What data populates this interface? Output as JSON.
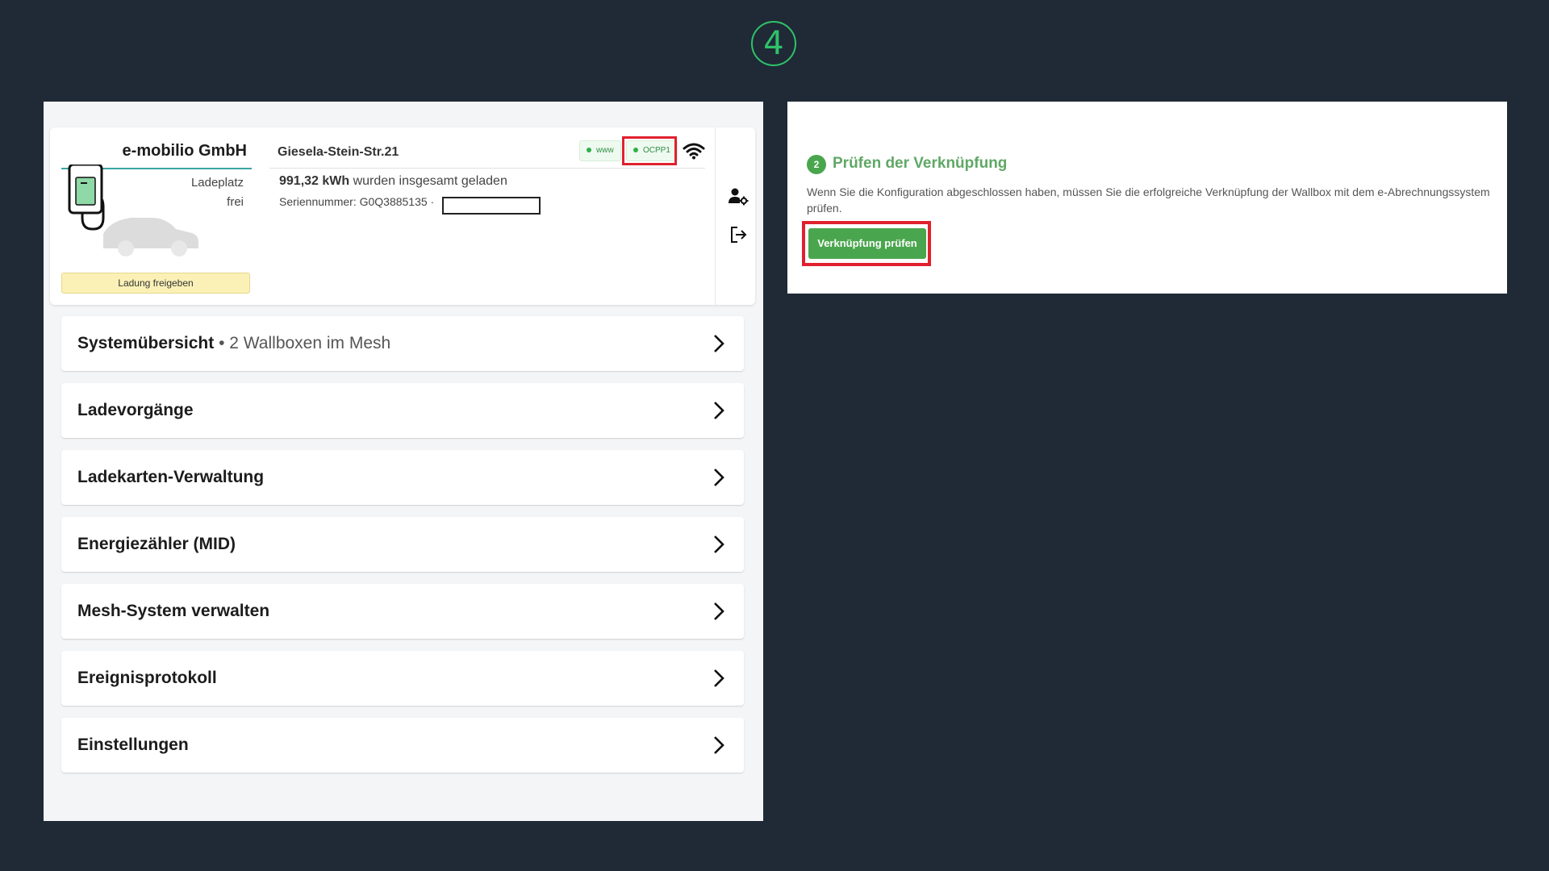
{
  "step_number": "4",
  "colors": {
    "background": "#1f2a36",
    "accent_green": "#4aa64e",
    "highlight_red": "#e0202e",
    "release_yellow": "#fbf1b7",
    "teal_underline": "#3aa6a1"
  },
  "left_panel": {
    "card": {
      "company": "e-mobilio GmbH",
      "ladeplatz_label": "Ladeplatz",
      "ladeplatz_status": "frei",
      "release_button": "Ladung freigeben",
      "address": "Giesela-Stein-Str.21",
      "badges": {
        "www": "www",
        "ocpp": "OCPP1"
      },
      "energy_value": "991,32 kWh",
      "energy_text": " wurden insgesamt geladen",
      "serial_text": "Seriennummer: G0Q3885135 ·",
      "icons": [
        "wifi-icon",
        "user-settings-icon",
        "logout-icon",
        "chevron-right-icon"
      ]
    },
    "menu": [
      {
        "label": "Systemübersicht",
        "sub": " • 2 Wallboxen im Mesh"
      },
      {
        "label": "Ladevorgänge",
        "sub": ""
      },
      {
        "label": "Ladekarten-Verwaltung",
        "sub": ""
      },
      {
        "label": "Energiezähler (MID)",
        "sub": ""
      },
      {
        "label": "Mesh-System verwalten",
        "sub": ""
      },
      {
        "label": "Ereignisprotokoll",
        "sub": ""
      },
      {
        "label": "Einstellungen",
        "sub": ""
      }
    ]
  },
  "right_panel": {
    "step_number": "2",
    "title": "Prüfen der Verknüpfung",
    "description": "Wenn Sie die Konfiguration abgeschlossen haben, müssen Sie die erfolgreiche Verknüpfung der Wallbox mit dem e-Abrechnungssystem prüfen.",
    "button": "Verknüpfung prüfen"
  }
}
